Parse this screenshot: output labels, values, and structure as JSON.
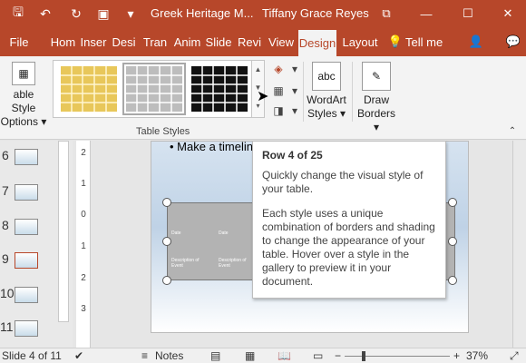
{
  "titlebar": {
    "doc_title": "Greek Heritage M...",
    "user_name": "Tiffany Grace Reyes",
    "qa_icons": [
      "save-icon",
      "undo-icon",
      "redo-icon",
      "present-icon",
      "customize-icon"
    ],
    "qa_glyphs": [
      "🖫",
      "↶",
      "↻",
      "▣",
      "▾"
    ],
    "window_glyphs": [
      "⧉",
      "—",
      "☐",
      "✕"
    ]
  },
  "tabs": {
    "file": "File",
    "items": [
      "Hom",
      "Inser",
      "Desi",
      "Tran",
      "Anim",
      "Slide",
      "Revi",
      "View",
      "Design",
      "Layout"
    ],
    "tell_me": "Tell me",
    "bulb_glyph": "💡",
    "share_glyph": "👤",
    "comment_glyph": "💬"
  },
  "ribbon": {
    "table_style_options_line1": "able Style",
    "table_style_options_line2": "Options",
    "dropdown_glyph": "▾",
    "group_label": "Table Styles",
    "wordart_line1": "WordArt",
    "wordart_line2": "Styles",
    "wordart_icon_text": "abc",
    "draw_borders_line1": "Draw",
    "draw_borders_line2": "Borders",
    "shading_glyph": "◈",
    "borders_glyph": "▦",
    "effects_glyph": "◨",
    "draw_glyph": "✎",
    "gallery_up": "▲",
    "gallery_down": "▼",
    "gallery_more": "▾"
  },
  "thumbnails": {
    "numbers": [
      "6",
      "7",
      "8",
      "9",
      "10",
      "11"
    ],
    "current": "9"
  },
  "ruler": [
    "2",
    "1",
    "0",
    "1",
    "2",
    "3"
  ],
  "slide": {
    "bullet_text": "Make a timelin",
    "cells": [
      "Date",
      "Date",
      "Description of Event",
      "Description of Event"
    ]
  },
  "tooltip": {
    "title": "Row 4 of 25",
    "para1": "Quickly change the visual style of your table.",
    "para2": "Each style uses a unique combination of borders and shading to change the appearance of your table. Hover over a style in the gallery to preview it in your document."
  },
  "status": {
    "slide_info": "Slide 4 of 11",
    "notes_label": "Notes",
    "zoom_pct": "37%",
    "zoom_minus": "−",
    "zoom_plus": "+",
    "notes_icon": "≡",
    "comments_icon": "▭",
    "normal_icon": "▤",
    "sorter_icon": "▦",
    "reading_icon": "📖",
    "slideshow_icon": "▭",
    "fit_icon": "⤢",
    "spell_icon": "✔"
  },
  "colors": {
    "accent": "#b7472a",
    "style_gold": "#e8c75a",
    "style_gray": "#bdbdbd",
    "style_black": "#111111"
  }
}
